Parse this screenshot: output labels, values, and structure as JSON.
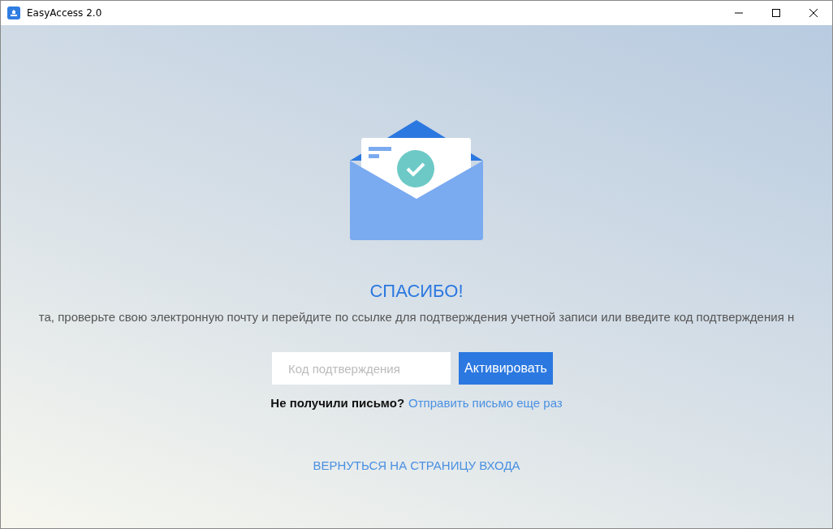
{
  "window": {
    "title": "EasyAccess 2.0"
  },
  "heading": "СПАСИБО!",
  "message": "та, проверьте свою электронную почту и перейдите по ссылке для подтверждения учетной записи или введите код подтверждения н",
  "code_field": {
    "placeholder": "Код подтверждения"
  },
  "activate_button": "Активировать",
  "resend": {
    "prompt": "Не получили письмо?",
    "link": "Отправить письмо еще раз"
  },
  "back_link": "ВЕРНУТЬСЯ НА СТРАНИЦУ ВХОДА"
}
